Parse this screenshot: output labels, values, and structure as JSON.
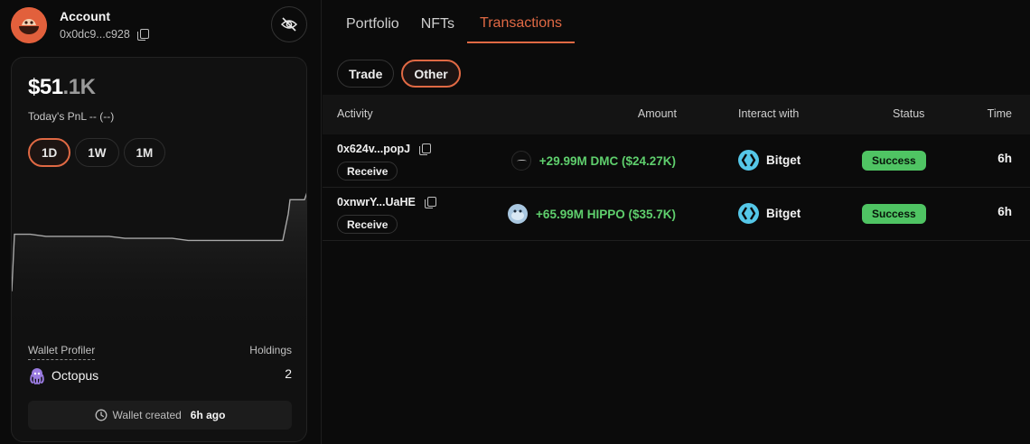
{
  "account": {
    "title": "Account",
    "address": "0x0dc9...c928"
  },
  "balance": {
    "main": "$51",
    "suffix": ".1K"
  },
  "pnl": {
    "label": "Today's PnL",
    "value": "-- (--)"
  },
  "ranges": [
    "1D",
    "1W",
    "1M"
  ],
  "active_range": "1D",
  "chart_data": {
    "type": "line",
    "y": [
      0.55,
      0.83,
      0.83,
      0.82,
      0.82,
      0.82,
      0.82,
      0.82,
      0.81,
      0.81,
      0.81,
      0.81,
      0.8,
      0.8,
      0.8,
      0.8,
      0.8,
      0.8,
      0.8,
      0.93,
      1.0,
      1.0,
      1.05
    ]
  },
  "profiler": {
    "label": "Wallet Profiler",
    "value": "Octopus"
  },
  "holdings": {
    "label": "Holdings",
    "value": "2"
  },
  "wallet_created": {
    "label": "Wallet created",
    "value": "6h ago"
  },
  "tabs": [
    "Portfolio",
    "NFTs",
    "Transactions"
  ],
  "active_tab": "Transactions",
  "filters": [
    "Trade",
    "Other"
  ],
  "active_filter": "Other",
  "table": {
    "headers": {
      "activity": "Activity",
      "amount": "Amount",
      "interact": "Interact with",
      "status": "Status",
      "time": "Time"
    },
    "rows": [
      {
        "hash": "0x624v...popJ",
        "type": "Receive",
        "amount": "+29.99M DMC ($24.27K)",
        "token_icon": "dmc-token-icon",
        "interact": "Bitget",
        "status": "Success",
        "time": "6h"
      },
      {
        "hash": "0xnwrY...UaHE",
        "type": "Receive",
        "amount": "+65.99M HIPPO ($35.7K)",
        "token_icon": "hippo-token-icon",
        "interact": "Bitget",
        "status": "Success",
        "time": "6h"
      }
    ]
  },
  "colors": {
    "accent": "#e06944",
    "positive": "#5fcf6d",
    "success_badge": "#4fc463",
    "bitget": "#55c7e8"
  }
}
